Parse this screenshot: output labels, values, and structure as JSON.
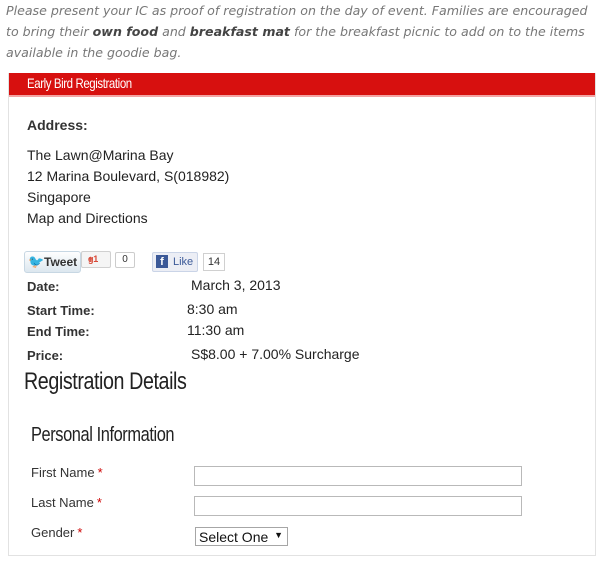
{
  "intro": {
    "part1": "Please present your IC as proof of registration on the day of event. Families are encouraged to bring their ",
    "bold1": "own food",
    "part2": " and ",
    "bold2": "breakfast mat",
    "part3": " for the breakfast picnic to add on to the items available in the goodie bag."
  },
  "panel": {
    "title": "Early Bird Registration"
  },
  "address": {
    "label": "Address:",
    "lines": [
      "The Lawn@Marina Bay",
      "12 Marina Boulevard, S(018982)",
      "Singapore",
      "Map and Directions"
    ]
  },
  "social": {
    "tweet_label": "Tweet",
    "gplus_label": "+1",
    "gplus_count": "0",
    "fb_label": "Like",
    "fb_count": "14"
  },
  "details": {
    "date_label": "Date:",
    "date_value": "March 3, 2013",
    "start_label": "Start Time:",
    "start_value": "8:30 am",
    "end_label": "End Time:",
    "end_value": "11:30 am",
    "price_label": "Price:",
    "price_value": "S$8.00 + 7.00% Surcharge"
  },
  "registration": {
    "heading": "Registration Details",
    "section": "Personal Information",
    "first_name_label": "First Name",
    "last_name_label": "Last Name",
    "gender_label": "Gender",
    "required_mark": "*",
    "gender_selected": "Select One"
  }
}
